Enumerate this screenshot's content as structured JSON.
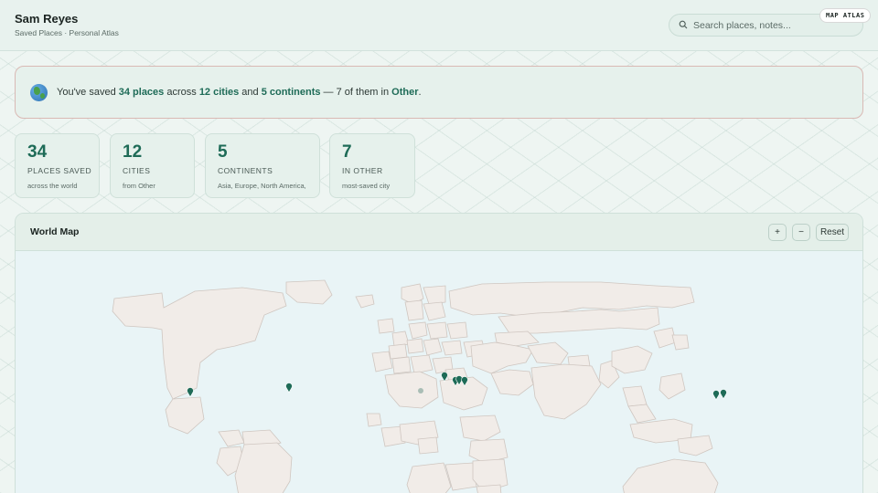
{
  "header": {
    "user_name": "Sam Reyes",
    "subtitle": "Saved Places · Personal Atlas",
    "search_placeholder": "Search places, notes...",
    "badge": "MAP ATLAS"
  },
  "banner": {
    "prefix": "You've saved ",
    "places": "34 places",
    "mid1": " across ",
    "cities": "12 cities",
    "mid2": " and ",
    "continents": "5 continents",
    "mid3": " — 7 of them in ",
    "top_city": "Other",
    "suffix": "."
  },
  "stats": [
    {
      "number": "34",
      "label": "PLACES SAVED",
      "sub": "across the world"
    },
    {
      "number": "12",
      "label": "CITIES",
      "sub": "from Other"
    },
    {
      "number": "5",
      "label": "CONTINENTS",
      "sub": "Asia, Europe, North America,"
    },
    {
      "number": "7",
      "label": "IN OTHER",
      "sub": "most-saved city"
    }
  ],
  "map": {
    "title": "World Map",
    "zoom_in": "+",
    "zoom_out": "−",
    "reset": "Reset",
    "land_color": "#f1ece8",
    "water_color": "#e9f4f6",
    "pin_color": "#1e6b57"
  }
}
